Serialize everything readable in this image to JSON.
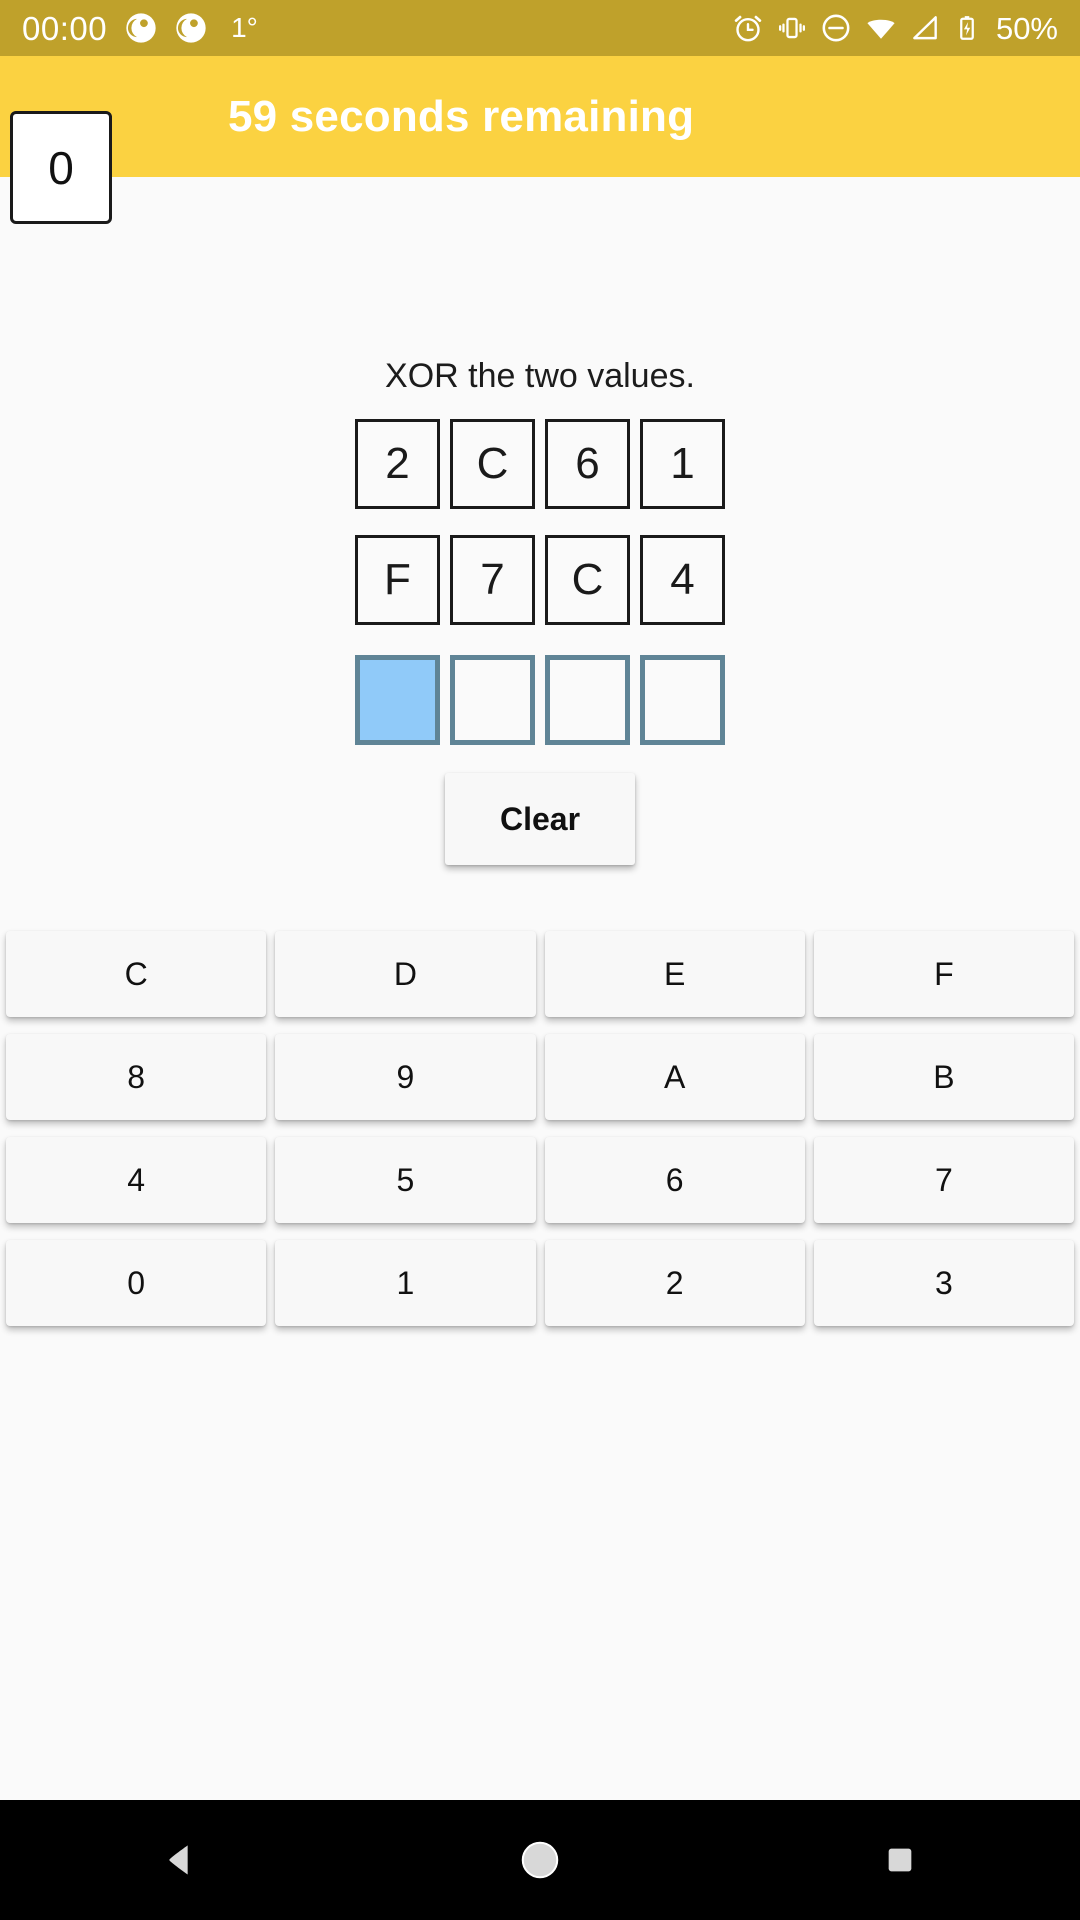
{
  "status_bar": {
    "clock": "00:00",
    "temperature": "1°",
    "battery_percent": "50%",
    "background_color": "#BFA12B",
    "notification_icons": [
      "app-notification-icon",
      "app-notification-icon"
    ],
    "system_icons": [
      "alarm-icon",
      "vibrate-icon",
      "do-not-disturb-icon",
      "wifi-icon",
      "cell-signal-icon",
      "battery-charging-icon"
    ]
  },
  "app_bar": {
    "score": "0",
    "timer_label": "59 seconds remaining",
    "background_color": "#FBD241",
    "title_color": "#FFFFFF"
  },
  "puzzle": {
    "prompt": "XOR the two values.",
    "operand_a": [
      "2",
      "C",
      "6",
      "1"
    ],
    "operand_b": [
      "F",
      "7",
      "C",
      "4"
    ],
    "answer": [
      "",
      "",
      "",
      ""
    ],
    "selected_answer_index": 0,
    "selected_cell_color": "#90CAF9",
    "answer_border_color": "#5F8496",
    "operand_border_color": "#1A1A1A"
  },
  "clear_button": {
    "label": "Clear"
  },
  "keypad": {
    "rows": [
      [
        "C",
        "D",
        "E",
        "F"
      ],
      [
        "8",
        "9",
        "A",
        "B"
      ],
      [
        "4",
        "5",
        "6",
        "7"
      ],
      [
        "0",
        "1",
        "2",
        "3"
      ]
    ]
  },
  "nav_bar": {
    "back_label": "back-button",
    "home_label": "home-button",
    "recents_label": "recents-button",
    "background_color": "#000000"
  }
}
